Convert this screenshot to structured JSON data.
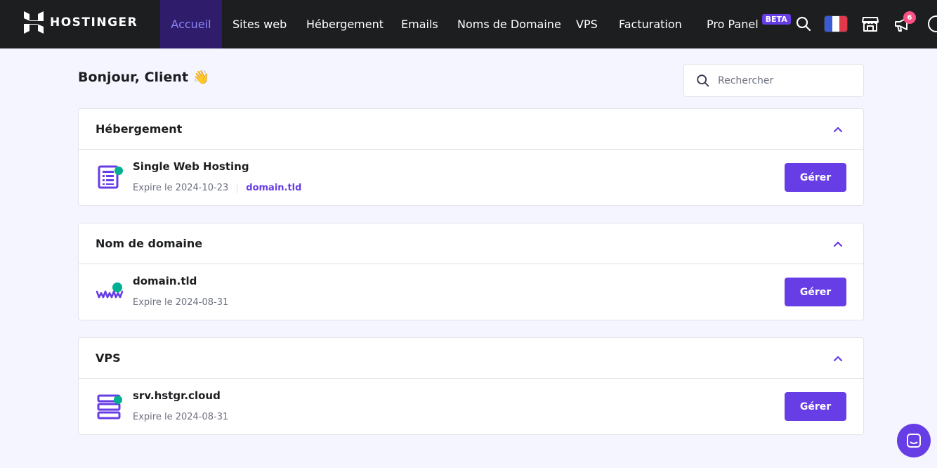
{
  "brand": {
    "name": "HOSTINGER",
    "logo_icon": "hostinger-logo-icon"
  },
  "nav": {
    "items": [
      {
        "label": "Accueil",
        "active": true
      },
      {
        "label": "Sites web"
      },
      {
        "label": "Hébergement"
      },
      {
        "label": "Emails"
      },
      {
        "label": "Noms de Domaine"
      },
      {
        "label": "VPS"
      },
      {
        "label": "Facturation"
      },
      {
        "label": "Pro Panel",
        "badge": "BETA"
      }
    ],
    "icons": {
      "search": "search-icon",
      "language": "flag-fr-icon",
      "store": "store-icon",
      "notifications": "megaphone-icon",
      "notifications_count": "6",
      "help": "help-icon"
    }
  },
  "greeting": "Bonjour, Client 👋",
  "search": {
    "placeholder": "Rechercher"
  },
  "sections": [
    {
      "title": "Hébergement",
      "item": {
        "name": "Single Web Hosting",
        "expiry": "Expire le 2024-10-23",
        "link": "domain.tld",
        "icon": "hosting-plan-icon"
      },
      "button": "Gérer"
    },
    {
      "title": "Nom de domaine",
      "item": {
        "name": "domain.tld",
        "expiry": "Expire le 2024-08-31",
        "icon": "www-domain-icon"
      },
      "button": "Gérer"
    },
    {
      "title": "VPS",
      "item": {
        "name": "srv.hstgr.cloud",
        "expiry": "Expire le 2024-08-31",
        "icon": "vps-server-icon"
      },
      "button": "Gérer"
    }
  ],
  "colors": {
    "primary": "#673de6",
    "topbar": "#1d1e20",
    "active_nav_bg": "#2f1c6a",
    "active_nav_text": "#8c85ff",
    "accent_dot": "#00b090",
    "background": "#f4f5ff"
  },
  "chat_icon": "chat-icon"
}
